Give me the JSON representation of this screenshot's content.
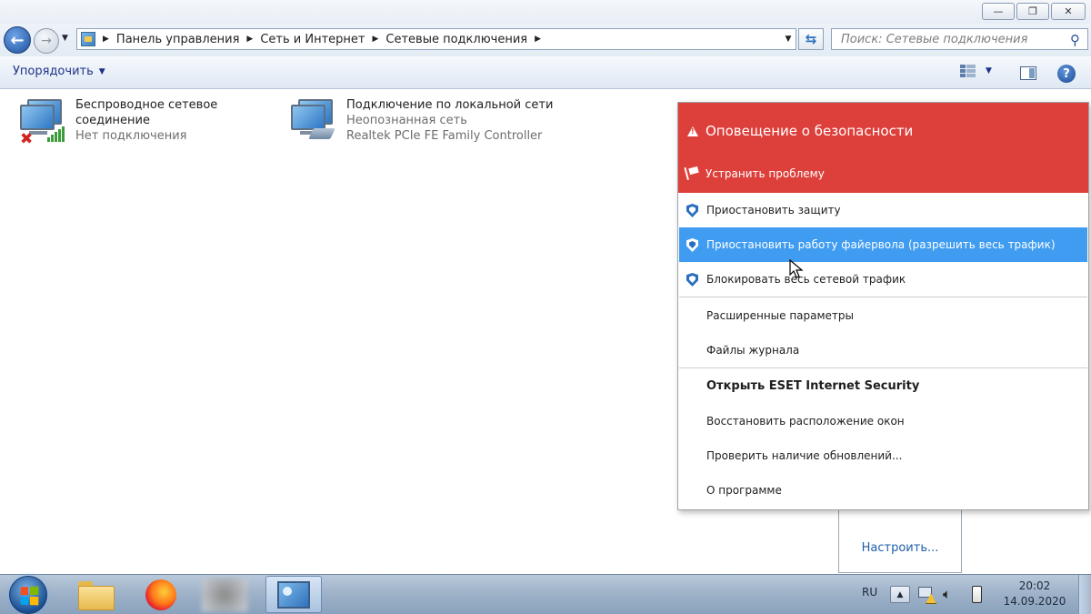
{
  "window": {
    "minimize_glyph": "—",
    "maximize_glyph": "❐",
    "close_glyph": "✕"
  },
  "address_bar": {
    "crumbs": [
      "Панель управления",
      "Сеть и Интернет",
      "Сетевые подключения"
    ],
    "search_placeholder": "Поиск: Сетевые подключения"
  },
  "toolbar": {
    "organize_label": "Упорядочить"
  },
  "connections": [
    {
      "name_line1": "Беспроводное сетевое",
      "name_line2": "соединение",
      "status": "Нет подключения",
      "icon": "wireless-network-icon"
    },
    {
      "name": "Подключение по локальной сети",
      "status": "Неопознанная сеть",
      "adapter": "Realtek PCIe FE Family Controller",
      "icon": "ethernet-network-icon"
    }
  ],
  "context_menu": {
    "alert_title": "Оповещение о безопасности",
    "fix_label": "Устранить проблему",
    "items": [
      "Приостановить защиту",
      "Приостановить работу файервола (разрешить весь трафик)",
      "Блокировать весь сетевой трафик",
      "Расширенные параметры",
      "Файлы журнала",
      "Открыть ESET Internet Security",
      "Восстановить расположение окон",
      "Проверить наличие обновлений...",
      "О программе"
    ],
    "highlighted_index": 1,
    "accent_color": "#dd3f3b",
    "highlight_color": "#3f9cf0"
  },
  "tray_popup": {
    "customize_label": "Настроить..."
  },
  "taskbar": {
    "language": "RU",
    "time": "20:02",
    "date": "14.09.2020"
  }
}
